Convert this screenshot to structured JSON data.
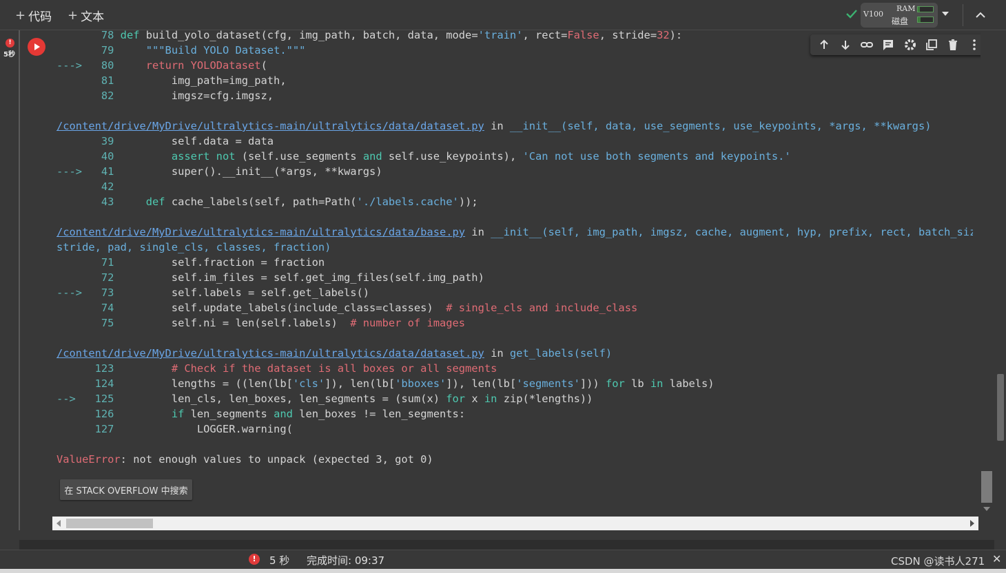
{
  "toolbar": {
    "add_code": "代码",
    "add_text": "文本",
    "runtime_gpu": "V100",
    "ram_label": "RAM",
    "disk_label": "磁盘",
    "ram_usage": 0.15,
    "disk_usage": 0.2
  },
  "cell": {
    "exec_time": "5秒"
  },
  "traceback": [
    {
      "ln": "78",
      "arrow": "",
      "tokens": [
        [
          "kw",
          "def "
        ],
        [
          "",
          "build_yolo_dataset(cfg, img_path, batch, data, mode="
        ],
        [
          "str",
          "'train'"
        ],
        [
          "",
          ", rect="
        ],
        [
          "kwp",
          "False"
        ],
        [
          "",
          ", stride="
        ],
        [
          "kwp",
          "32"
        ],
        [
          "",
          "):"
        ]
      ]
    },
    {
      "ln": "79",
      "arrow": "",
      "tokens": [
        [
          "",
          "    "
        ],
        [
          "str",
          "\"\"\"Build YOLO Dataset.\"\"\""
        ]
      ]
    },
    {
      "ln": "80",
      "arrow": "--->",
      "tokens": [
        [
          "",
          "    "
        ],
        [
          "kwp",
          "return "
        ],
        [
          "kwp",
          "YOLODataset"
        ],
        [
          "",
          "("
        ]
      ]
    },
    {
      "ln": "81",
      "arrow": "",
      "tokens": [
        [
          "",
          "        img_path=img_path,"
        ]
      ]
    },
    {
      "ln": "82",
      "arrow": "",
      "tokens": [
        [
          "",
          "        imgsz=cfg.imgsz,"
        ]
      ]
    },
    {
      "blank": true
    },
    {
      "path": "/content/drive/MyDrive/ultralytics-main/ultralytics/data/dataset.py",
      "rest": [
        [
          "",
          " in "
        ],
        [
          "fn",
          "__init__"
        ],
        [
          "fn",
          "(self, data, use_segments, use_keypoints, *args, **kwargs)"
        ]
      ]
    },
    {
      "ln": "39",
      "arrow": "",
      "tokens": [
        [
          "",
          "        self.data = data"
        ]
      ]
    },
    {
      "ln": "40",
      "arrow": "",
      "tokens": [
        [
          "",
          "        "
        ],
        [
          "kw",
          "assert not "
        ],
        [
          "",
          "(self.use_segments "
        ],
        [
          "kw",
          "and "
        ],
        [
          "",
          "self.use_keypoints), "
        ],
        [
          "str",
          "'Can not use both segments and keypoints.'"
        ]
      ]
    },
    {
      "ln": "41",
      "arrow": "--->",
      "tokens": [
        [
          "",
          "        super().__init__(*args, **kwargs)"
        ]
      ]
    },
    {
      "ln": "42",
      "arrow": "",
      "tokens": []
    },
    {
      "ln": "43",
      "arrow": "",
      "tokens": [
        [
          "",
          "    "
        ],
        [
          "kw",
          "def "
        ],
        [
          "",
          "cache_labels(self, path=Path("
        ],
        [
          "str",
          "'./labels.cache'"
        ],
        [
          "",
          "));"
        ]
      ]
    },
    {
      "blank": true
    },
    {
      "path": "/content/drive/MyDrive/ultralytics-main/ultralytics/data/base.py",
      "rest": [
        [
          "",
          " in "
        ],
        [
          "fn",
          "__init__"
        ],
        [
          "fn",
          "(self, img_path, imgsz, cache, augment, hyp, prefix, rect, batch_size,"
        ]
      ]
    },
    {
      "cont": [
        [
          "fn",
          "stride, pad, single_cls, classes, fraction)"
        ]
      ]
    },
    {
      "ln": "71",
      "arrow": "",
      "tokens": [
        [
          "",
          "        self.fraction = fraction"
        ]
      ]
    },
    {
      "ln": "72",
      "arrow": "",
      "tokens": [
        [
          "",
          "        self.im_files = self.get_img_files(self.img_path)"
        ]
      ]
    },
    {
      "ln": "73",
      "arrow": "--->",
      "tokens": [
        [
          "",
          "        self.labels = self.get_labels()"
        ]
      ]
    },
    {
      "ln": "74",
      "arrow": "",
      "tokens": [
        [
          "",
          "        self.update_labels(include_class=classes)  "
        ],
        [
          "cmt",
          "# single_cls and include_class"
        ]
      ]
    },
    {
      "ln": "75",
      "arrow": "",
      "tokens": [
        [
          "",
          "        self.ni = len(self.labels)  "
        ],
        [
          "cmt",
          "# number of images"
        ]
      ]
    },
    {
      "blank": true
    },
    {
      "path": "/content/drive/MyDrive/ultralytics-main/ultralytics/data/dataset.py",
      "rest": [
        [
          "",
          " in "
        ],
        [
          "fn",
          "get_labels(self)"
        ]
      ]
    },
    {
      "ln": "123",
      "arrow": "",
      "tokens": [
        [
          "",
          "        "
        ],
        [
          "cmt",
          "# Check if the dataset is all boxes or all segments"
        ]
      ]
    },
    {
      "ln": "124",
      "arrow": "",
      "tokens": [
        [
          "",
          "        lengths = ((len(lb["
        ],
        [
          "str",
          "'cls'"
        ],
        [
          "",
          "]), len(lb["
        ],
        [
          "str",
          "'bboxes'"
        ],
        [
          "",
          "]), len(lb["
        ],
        [
          "str",
          "'segments'"
        ],
        [
          "",
          "])) "
        ],
        [
          "kw",
          "for "
        ],
        [
          "",
          "lb "
        ],
        [
          "kw",
          "in "
        ],
        [
          "",
          "labels)"
        ]
      ]
    },
    {
      "ln": "125",
      "arrow": "-->",
      "tokens": [
        [
          "",
          "        len_cls, len_boxes, len_segments = (sum(x) "
        ],
        [
          "kw",
          "for "
        ],
        [
          "",
          "x "
        ],
        [
          "kw",
          "in "
        ],
        [
          "",
          "zip(*lengths))"
        ]
      ]
    },
    {
      "ln": "126",
      "arrow": "",
      "tokens": [
        [
          "",
          "        "
        ],
        [
          "kw",
          "if "
        ],
        [
          "",
          "len_segments "
        ],
        [
          "kw",
          "and "
        ],
        [
          "",
          "len_boxes != len_segments:"
        ]
      ]
    },
    {
      "ln": "127",
      "arrow": "",
      "tokens": [
        [
          "",
          "            LOGGER.warning("
        ]
      ]
    },
    {
      "blank": true
    },
    {
      "error": [
        [
          "err",
          "ValueError"
        ],
        [
          "",
          ": not enough values to unpack (expected 3, got 0)"
        ]
      ]
    }
  ],
  "search_button": "在 STACK OVERFLOW 中搜索",
  "status": {
    "duration": "5 秒",
    "completed_label": "完成时间: 09:37"
  },
  "watermark": "CSDN @读书人271"
}
